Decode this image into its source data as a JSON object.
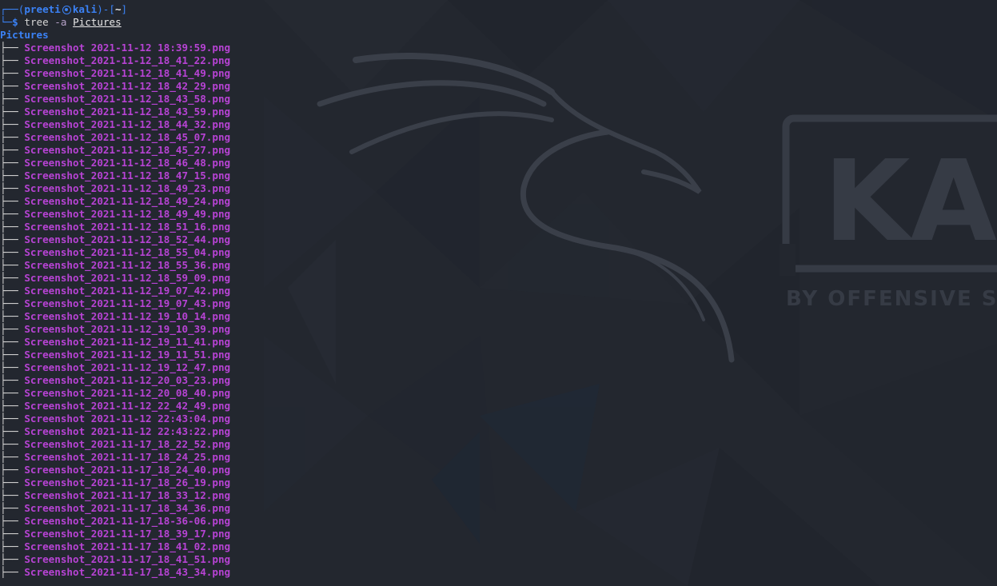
{
  "prompt": {
    "frame_open": "┌──(",
    "user_host": "preeti",
    "host": "kali",
    "frame_mid": ")-[",
    "cwd": "~",
    "frame_close": "]",
    "line2_prefix": "└─",
    "dollar": "$",
    "command": "tree",
    "flag": "-a",
    "argument": "Pictures"
  },
  "tree": {
    "root": "Pictures",
    "branch": "├── ",
    "files": [
      "Screenshot 2021-11-12 18:39:59.png",
      "Screenshot_2021-11-12_18_41_22.png",
      "Screenshot_2021-11-12_18_41_49.png",
      "Screenshot_2021-11-12_18_42_29.png",
      "Screenshot_2021-11-12_18_43_58.png",
      "Screenshot_2021-11-12_18_43_59.png",
      "Screenshot_2021-11-12_18_44_32.png",
      "Screenshot_2021-11-12_18_45_07.png",
      "Screenshot_2021-11-12_18_45_27.png",
      "Screenshot_2021-11-12_18_46_48.png",
      "Screenshot_2021-11-12_18_47_15.png",
      "Screenshot_2021-11-12_18_49_23.png",
      "Screenshot_2021-11-12_18_49_24.png",
      "Screenshot_2021-11-12_18_49_49.png",
      "Screenshot_2021-11-12_18_51_16.png",
      "Screenshot_2021-11-12_18_52_44.png",
      "Screenshot_2021-11-12_18_55_04.png",
      "Screenshot_2021-11-12_18_55_36.png",
      "Screenshot_2021-11-12_18_59_09.png",
      "Screenshot_2021-11-12_19_07_42.png",
      "Screenshot_2021-11-12_19_07_43.png",
      "Screenshot_2021-11-12_19_10_14.png",
      "Screenshot_2021-11-12_19_10_39.png",
      "Screenshot_2021-11-12_19_11_41.png",
      "Screenshot_2021-11-12_19_11_51.png",
      "Screenshot_2021-11-12_19_12_47.png",
      "Screenshot_2021-11-12_20_03_23.png",
      "Screenshot_2021-11-12_20_08_40.png",
      "Screenshot_2021-11-12_22_42_49.png",
      "Screenshot 2021-11-12 22:43:04.png",
      "Screenshot 2021-11-12 22:43:22.png",
      "Screenshot_2021-11-17_18_22_52.png",
      "Screenshot_2021-11-17_18_24_25.png",
      "Screenshot_2021-11-17_18_24_40.png",
      "Screenshot_2021-11-17_18_26_19.png",
      "Screenshot_2021-11-17_18_33_12.png",
      "Screenshot_2021-11-17_18_34_36.png",
      "Screenshot_2021-11-17_18-36-06.png",
      "Screenshot_2021-11-17_18_39_17.png",
      "Screenshot_2021-11-17_18_41_02.png",
      "Screenshot_2021-11-17_18_41_51.png",
      "Screenshot_2021-11-17_18_43_34.png"
    ]
  },
  "wallpaper": {
    "logo_text": "KALI",
    "tagline": "BY OFFENSIVE SECURITY",
    "icon": "kali-dragon-icon"
  },
  "colors": {
    "background": "#23272f",
    "prompt_blue": "#3b82f6",
    "file_purple": "#b743d4"
  }
}
